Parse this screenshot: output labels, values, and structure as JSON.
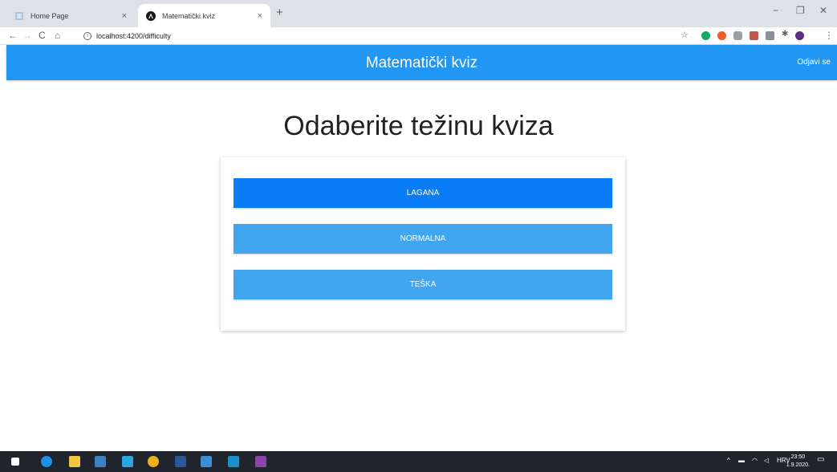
{
  "browser": {
    "tabs": [
      {
        "title": "Home Page",
        "active": false
      },
      {
        "title": "Matematički kviz",
        "active": true
      }
    ],
    "new_tab_icon": "+",
    "close_icon": "×",
    "url": "localhost:4200/difficulty",
    "window_controls": {
      "minimize": "−",
      "maximize": "❐",
      "close": "✕"
    }
  },
  "app": {
    "title": "Matematički kviz",
    "logout_label": "Odjavi se",
    "accent_color": "#2196f3"
  },
  "main": {
    "heading": "Odaberite težinu kviza",
    "difficulties": [
      {
        "label": "LAGANA",
        "color": "#0a7cf5",
        "selected": true
      },
      {
        "label": "NORMALNA",
        "color": "#42a5f0",
        "selected": false
      },
      {
        "label": "TEŠKA",
        "color": "#42a5f0",
        "selected": false
      }
    ]
  },
  "taskbar": {
    "language": "HRV",
    "time": "23:50",
    "date": "1.9.2020."
  }
}
